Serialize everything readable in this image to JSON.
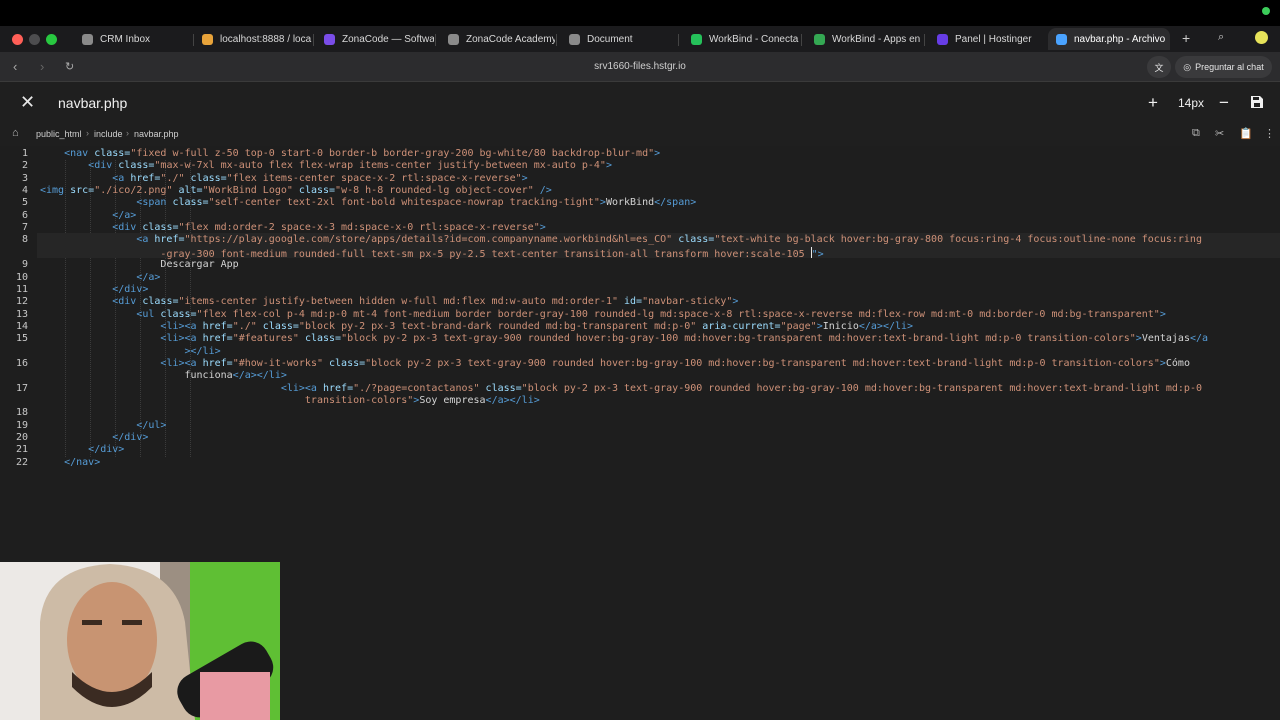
{
  "browser": {
    "tabs": [
      {
        "label": "CRM Inbox",
        "icon": "crm-icon",
        "color": "#8a8a8a"
      },
      {
        "label": "localhost:8888 / loca",
        "icon": "phpmyadmin-icon",
        "color": "#e8a33a"
      },
      {
        "label": "ZonaCode — Softwa",
        "icon": "zonacode-icon",
        "color": "#7a4de8"
      },
      {
        "label": "ZonaCode Academy",
        "icon": "academy-icon",
        "color": "#8a8a8a"
      },
      {
        "label": "Document",
        "icon": "document-icon",
        "color": "#8a8a8a"
      },
      {
        "label": "WorkBind - Conecta",
        "icon": "workbind-icon",
        "color": "#25c15a"
      },
      {
        "label": "WorkBind - Apps en",
        "icon": "play-store-icon",
        "color": "#34a853"
      },
      {
        "label": "Panel | Hostinger",
        "icon": "hostinger-icon",
        "color": "#673de6"
      },
      {
        "label": "navbar.php - Archivo",
        "icon": "hostinger-files-icon",
        "color": "#4aa3ff",
        "active": true
      }
    ],
    "url": "srv1660-files.hstgr.io",
    "ask_chat_label": "Preguntar al chat"
  },
  "editor": {
    "filename": "navbar.php",
    "font_size": "14px",
    "breadcrumb": [
      "public_html",
      "include",
      "navbar.php"
    ]
  },
  "code_lines": [
    {
      "n": "1",
      "rows": [
        [
          [
            "    ",
            "x"
          ],
          [
            "<nav ",
            "t"
          ],
          [
            "class=",
            "a"
          ],
          [
            "\"fixed w-full z-50 top-0 start-0 border-b border-gray-200 bg-white/80 backdrop-blur-md\"",
            "s"
          ],
          [
            ">",
            "t"
          ]
        ]
      ]
    },
    {
      "n": "2",
      "rows": [
        [
          [
            "        ",
            "x"
          ],
          [
            "<div ",
            "t"
          ],
          [
            "class=",
            "a"
          ],
          [
            "\"max-w-7xl mx-auto flex flex-wrap items-center justify-between mx-auto p-4\"",
            "s"
          ],
          [
            ">",
            "t"
          ]
        ]
      ]
    },
    {
      "n": "3",
      "rows": [
        [
          [
            "            ",
            "x"
          ],
          [
            "<a ",
            "t"
          ],
          [
            "href=",
            "a"
          ],
          [
            "\"./\" ",
            "s"
          ],
          [
            "class=",
            "a"
          ],
          [
            "\"flex items-center space-x-2 rtl:space-x-reverse\"",
            "s"
          ],
          [
            ">",
            "t"
          ]
        ]
      ]
    },
    {
      "n": "4",
      "rows": [
        [
          [
            "<img ",
            "t"
          ],
          [
            "src=",
            "a"
          ],
          [
            "\"./ico/2.png\" ",
            "s"
          ],
          [
            "alt=",
            "a"
          ],
          [
            "\"WorkBind Logo\" ",
            "s"
          ],
          [
            "class=",
            "a"
          ],
          [
            "\"w-8 h-8 rounded-lg object-cover\" ",
            "s"
          ],
          [
            "/>",
            "t"
          ]
        ]
      ]
    },
    {
      "n": "5",
      "rows": [
        [
          [
            "                ",
            "x"
          ],
          [
            "<span ",
            "t"
          ],
          [
            "class=",
            "a"
          ],
          [
            "\"self-center text-2xl font-bold whitespace-nowrap tracking-tight\"",
            "s"
          ],
          [
            ">",
            "t"
          ],
          [
            "WorkBind",
            "x"
          ],
          [
            "</span>",
            "t"
          ]
        ]
      ]
    },
    {
      "n": "6",
      "rows": [
        [
          [
            "            ",
            "x"
          ],
          [
            "</a>",
            "t"
          ]
        ]
      ]
    },
    {
      "n": "7",
      "rows": [
        [
          [
            "            ",
            "x"
          ],
          [
            "<div ",
            "t"
          ],
          [
            "class=",
            "a"
          ],
          [
            "\"flex md:order-2 space-x-3 md:space-x-0 rtl:space-x-reverse\"",
            "s"
          ],
          [
            ">",
            "t"
          ]
        ]
      ]
    },
    {
      "n": "8",
      "rows": [
        [
          [
            "                ",
            "x"
          ],
          [
            "<a ",
            "t"
          ],
          [
            "href=",
            "a"
          ],
          [
            "\"https://play.google.com/store/apps/details?id=com.companyname.workbind&hl=es_CO\" ",
            "s"
          ],
          [
            "class=",
            "a"
          ],
          [
            "\"text-white bg-black hover:bg-gray-800 focus:ring-4 focus:outline-none focus:ring",
            "s"
          ]
        ],
        [
          [
            "                    ",
            "x"
          ],
          [
            "-gray-300 font-medium rounded-full text-sm px-5 py-2.5 text-center transition-all transform hover:scale-105 ",
            "s"
          ],
          [
            "|",
            "cursor"
          ],
          [
            "\">",
            "t"
          ]
        ]
      ]
    },
    {
      "n": "9",
      "rows": [
        [
          [
            "                    ",
            "x"
          ],
          [
            "Descargar App",
            "x"
          ]
        ]
      ]
    },
    {
      "n": "10",
      "rows": [
        [
          [
            "                ",
            "x"
          ],
          [
            "</a>",
            "t"
          ]
        ]
      ]
    },
    {
      "n": "11",
      "rows": [
        [
          [
            "            ",
            "x"
          ],
          [
            "</div>",
            "t"
          ]
        ]
      ]
    },
    {
      "n": "12",
      "rows": [
        [
          [
            "            ",
            "x"
          ],
          [
            "<div ",
            "t"
          ],
          [
            "class=",
            "a"
          ],
          [
            "\"items-center justify-between hidden w-full md:flex md:w-auto md:order-1\" ",
            "s"
          ],
          [
            "id=",
            "a"
          ],
          [
            "\"navbar-sticky\"",
            "s"
          ],
          [
            ">",
            "t"
          ]
        ]
      ]
    },
    {
      "n": "13",
      "rows": [
        [
          [
            "                ",
            "x"
          ],
          [
            "<ul ",
            "t"
          ],
          [
            "class=",
            "a"
          ],
          [
            "\"flex flex-col p-4 md:p-0 mt-4 font-medium border border-gray-100 rounded-lg md:space-x-8 rtl:space-x-reverse md:flex-row md:mt-0 md:border-0 md:bg-transparent\"",
            "s"
          ],
          [
            ">",
            "t"
          ]
        ]
      ]
    },
    {
      "n": "14",
      "rows": [
        [
          [
            "                    ",
            "x"
          ],
          [
            "<li><a ",
            "t"
          ],
          [
            "href=",
            "a"
          ],
          [
            "\"./\" ",
            "s"
          ],
          [
            "class=",
            "a"
          ],
          [
            "\"block py-2 px-3 text-brand-dark rounded md:bg-transparent md:p-0\" ",
            "s"
          ],
          [
            "aria-current=",
            "a"
          ],
          [
            "\"page\"",
            "s"
          ],
          [
            ">",
            "t"
          ],
          [
            "Inicio",
            "x"
          ],
          [
            "</a></li>",
            "t"
          ]
        ]
      ]
    },
    {
      "n": "15",
      "rows": [
        [
          [
            "                    ",
            "x"
          ],
          [
            "<li><a ",
            "t"
          ],
          [
            "href=",
            "a"
          ],
          [
            "\"#features\" ",
            "s"
          ],
          [
            "class=",
            "a"
          ],
          [
            "\"block py-2 px-3 text-gray-900 rounded hover:bg-gray-100 md:hover:bg-transparent md:hover:text-brand-light md:p-0 transition-colors\"",
            "s"
          ],
          [
            ">",
            "t"
          ],
          [
            "Ventajas",
            "x"
          ],
          [
            "</a",
            "t"
          ]
        ],
        [
          [
            "                        ",
            "x"
          ],
          [
            "></li>",
            "t"
          ]
        ]
      ]
    },
    {
      "n": "16",
      "rows": [
        [
          [
            "                    ",
            "x"
          ],
          [
            "<li><a ",
            "t"
          ],
          [
            "href=",
            "a"
          ],
          [
            "\"#how-it-works\" ",
            "s"
          ],
          [
            "class=",
            "a"
          ],
          [
            "\"block py-2 px-3 text-gray-900 rounded hover:bg-gray-100 md:hover:bg-transparent md:hover:text-brand-light md:p-0 transition-colors\"",
            "s"
          ],
          [
            ">",
            "t"
          ],
          [
            "Cómo",
            "x"
          ]
        ],
        [
          [
            "                        ",
            "x"
          ],
          [
            "funciona",
            "x"
          ],
          [
            "</a></li>",
            "t"
          ]
        ]
      ]
    },
    {
      "n": "17",
      "rows": [
        [
          [
            "                                        ",
            "x"
          ],
          [
            "<li><a ",
            "t"
          ],
          [
            "href=",
            "a"
          ],
          [
            "\"./?page=contactanos\" ",
            "s"
          ],
          [
            "class=",
            "a"
          ],
          [
            "\"block py-2 px-3 text-gray-900 rounded hover:bg-gray-100 md:hover:bg-transparent md:hover:text-brand-light md:p-0",
            "s"
          ]
        ],
        [
          [
            "                                            ",
            "x"
          ],
          [
            "transition-colors\"",
            "s"
          ],
          [
            ">",
            "t"
          ],
          [
            "Soy empresa",
            "x"
          ],
          [
            "</a></li>",
            "t"
          ]
        ]
      ]
    },
    {
      "n": "18",
      "rows": [
        [
          [
            "",
            "x"
          ]
        ]
      ]
    },
    {
      "n": "19",
      "rows": [
        [
          [
            "                ",
            "x"
          ],
          [
            "</ul>",
            "t"
          ]
        ]
      ]
    },
    {
      "n": "20",
      "rows": [
        [
          [
            "            ",
            "x"
          ],
          [
            "</div>",
            "t"
          ]
        ]
      ]
    },
    {
      "n": "21",
      "rows": [
        [
          [
            "        ",
            "x"
          ],
          [
            "</div>",
            "t"
          ]
        ]
      ]
    },
    {
      "n": "22",
      "rows": [
        [
          [
            "    ",
            "x"
          ],
          [
            "</nav>",
            "t"
          ]
        ]
      ]
    }
  ]
}
